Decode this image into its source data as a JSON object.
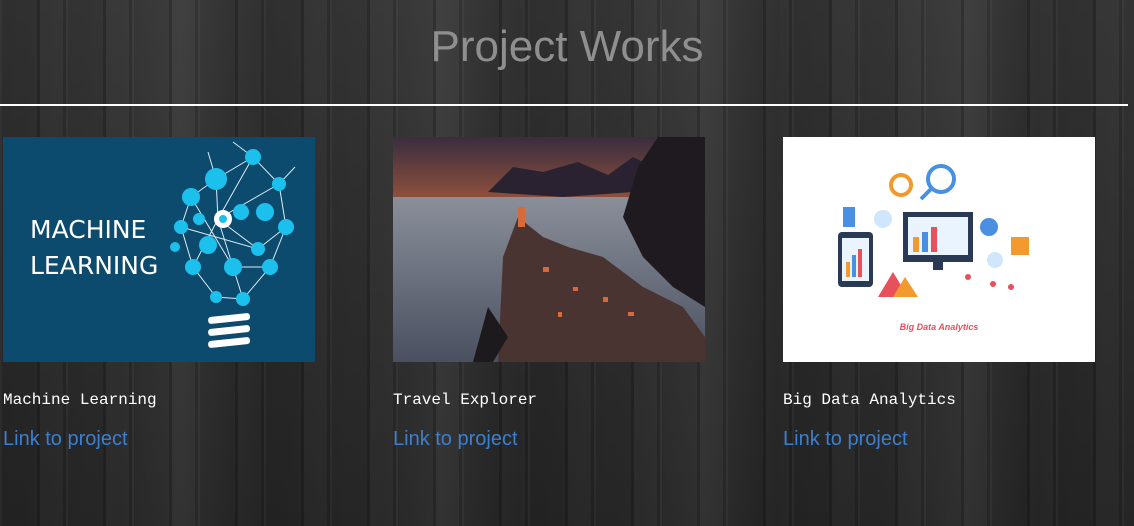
{
  "header": {
    "title": "Project Works"
  },
  "projects": [
    {
      "name": "Machine Learning",
      "link_label": "Link to project",
      "image_text": [
        "MACHINE",
        "LEARNING"
      ],
      "image_bg": "#0c4a6e"
    },
    {
      "name": "Travel Explorer",
      "link_label": "Link to project"
    },
    {
      "name": "Big Data Analytics",
      "link_label": "Link to project",
      "image_caption": "Big Data Analytics"
    }
  ],
  "colors": {
    "link": "#3d7fcf",
    "title": "#8f8f8f",
    "accent_cyan": "#1cc0ec"
  }
}
